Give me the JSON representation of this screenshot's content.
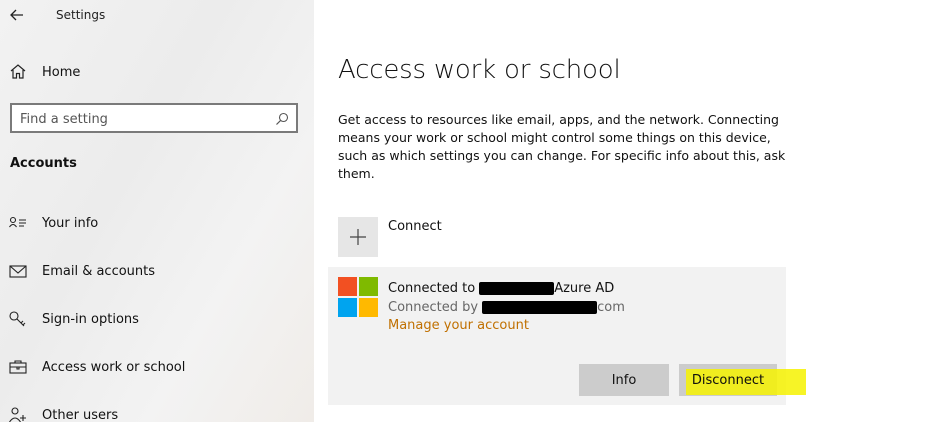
{
  "window": {
    "title": "Settings"
  },
  "sidebar": {
    "home_label": "Home",
    "search_placeholder": "Find a setting",
    "section_title": "Accounts",
    "items": [
      {
        "label": "Your info",
        "icon": "person-card-icon"
      },
      {
        "label": "Email & accounts",
        "icon": "mail-icon"
      },
      {
        "label": "Sign-in options",
        "icon": "key-icon"
      },
      {
        "label": "Access work or school",
        "icon": "briefcase-icon"
      },
      {
        "label": "Other users",
        "icon": "person-add-icon"
      }
    ]
  },
  "main": {
    "title": "Access work or school",
    "description": "Get access to resources like email, apps, and the network. Connecting means your work or school might control some things on this device, such as which settings you can change. For specific info about this, ask them.",
    "connect_label": "Connect",
    "account": {
      "connected_to_prefix": "Connected to",
      "connected_to_suffix": "Azure AD",
      "connected_by_prefix": "Connected by",
      "connected_by_suffix": "com",
      "manage_link": "Manage your account",
      "info_button": "Info",
      "disconnect_button": "Disconnect"
    }
  },
  "colors": {
    "link": "#c07000",
    "highlight": "#f6f200",
    "button_bg": "#cccccc",
    "card_bg": "#f2f2f2"
  }
}
